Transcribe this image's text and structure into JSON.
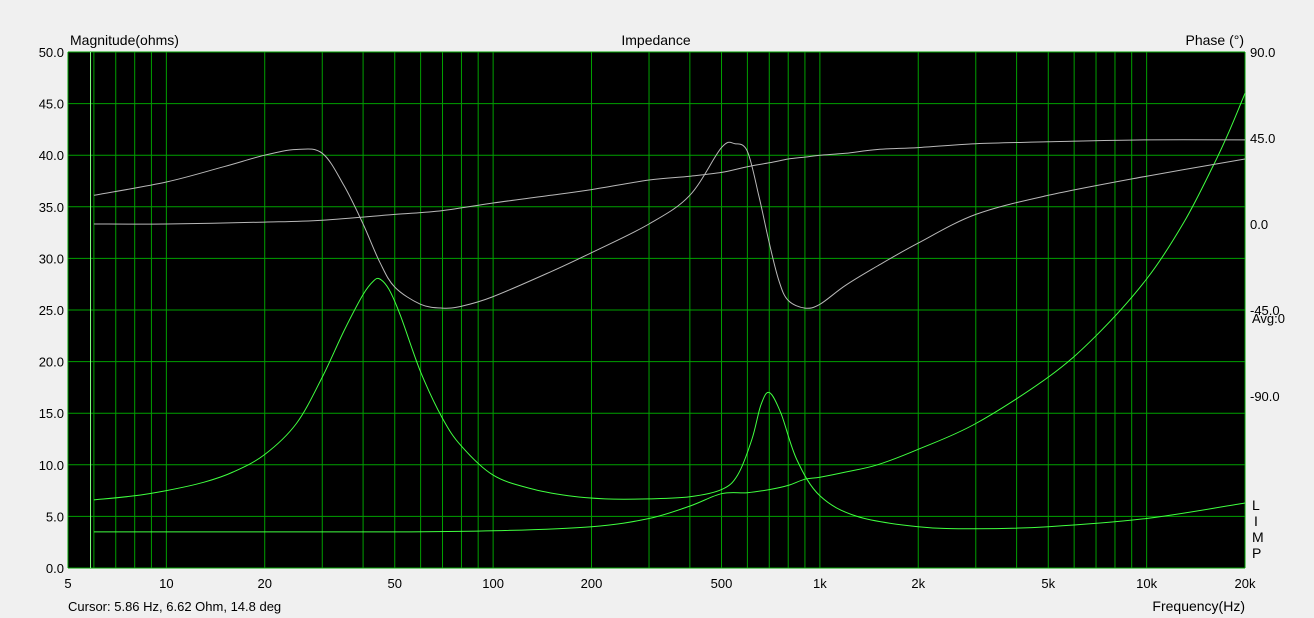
{
  "chart_data": {
    "type": "line",
    "title": "Impedance",
    "ylabel_left": "Magnitude(ohms)",
    "ylabel_right": "Phase (°)",
    "xlabel": "Frequency(Hz)",
    "x_scale": "log",
    "xlim": [
      5,
      20000
    ],
    "ylim_left": [
      0,
      50
    ],
    "ylim_right": [
      -180,
      90
    ],
    "x_ticks": [
      5,
      10,
      20,
      50,
      100,
      200,
      500,
      1000,
      2000,
      5000,
      10000,
      20000
    ],
    "x_tick_labels": [
      "5",
      "10",
      "20",
      "50",
      "100",
      "200",
      "500",
      "1k",
      "2k",
      "5k",
      "10k",
      "20k"
    ],
    "y_ticks_left": [
      0,
      5,
      10,
      15,
      20,
      25,
      30,
      35,
      40,
      45,
      50
    ],
    "y_tick_labels_left": [
      "0.0",
      "5.0",
      "10.0",
      "15.0",
      "20.0",
      "25.0",
      "30.0",
      "35.0",
      "40.0",
      "45.0",
      "50.0"
    ],
    "y_ticks_right": [
      90,
      45,
      0,
      -45,
      -90
    ],
    "y_tick_labels_right": [
      "90.0",
      "45.0",
      "0.0",
      "-45.0",
      "-90.0"
    ],
    "avg_label": "Avg:0",
    "grid": true,
    "legend_letters": [
      "L",
      "I",
      "M",
      "P"
    ],
    "cursor_readout": "Cursor: 5.86 Hz, 6.62 Ohm, 14.8 deg",
    "colors": {
      "plot_bg": "#000000",
      "grid": "#00a000",
      "magnitude": "#40ff40",
      "phase": "#b8b8b8"
    },
    "series": [
      {
        "axis": "left",
        "color": "#40ff40",
        "x": [
          6,
          8,
          10,
          13,
          16,
          20,
          25,
          30,
          35,
          40,
          43,
          45,
          48,
          52,
          60,
          70,
          80,
          100,
          130,
          170,
          220,
          300,
          400,
          500,
          560,
          620,
          660,
          700,
          760,
          850,
          1000,
          1300,
          2000,
          3000,
          5000,
          10000,
          20000
        ],
        "y": [
          6.6,
          7.0,
          7.5,
          8.3,
          9.3,
          11.0,
          14.0,
          18.5,
          23.0,
          26.5,
          27.8,
          28.0,
          27.0,
          24.5,
          19.0,
          14.5,
          11.8,
          9.0,
          7.7,
          7.0,
          6.7,
          6.7,
          6.9,
          7.6,
          9.0,
          12.5,
          15.8,
          17.0,
          15.0,
          10.5,
          7.0,
          5.0,
          4.0,
          3.8,
          4.0,
          4.8,
          6.3
        ]
      },
      {
        "axis": "left",
        "color": "#40ff40",
        "x": [
          6,
          20,
          50,
          100,
          200,
          300,
          400,
          500,
          600,
          700,
          800,
          900,
          1000,
          1200,
          1500,
          2000,
          3000,
          5000,
          7000,
          10000,
          13000,
          16000,
          18000,
          20000
        ],
        "y": [
          3.5,
          3.5,
          3.5,
          3.6,
          4.0,
          4.8,
          6.0,
          7.2,
          7.3,
          7.6,
          8.0,
          8.6,
          8.8,
          9.3,
          10.0,
          11.5,
          14.0,
          18.5,
          22.5,
          28.0,
          33.5,
          39.0,
          42.5,
          46.0
        ]
      },
      {
        "axis": "right",
        "color": "#b8b8b8",
        "x": [
          6,
          10,
          15,
          20,
          25,
          30,
          35,
          40,
          45,
          50,
          60,
          70,
          80,
          100,
          150,
          200,
          300,
          400,
          500,
          550,
          600,
          650,
          700,
          750,
          800,
          900,
          1000,
          1200,
          1500,
          2000,
          3000,
          5000,
          10000,
          20000
        ],
        "y": [
          15,
          22,
          30,
          36,
          39,
          37,
          20,
          0,
          -20,
          -33,
          -42,
          -44,
          -43,
          -38,
          -25,
          -15,
          0,
          15,
          40,
          42,
          38,
          15,
          -10,
          -30,
          -40,
          -44,
          -42,
          -32,
          -22,
          -10,
          5,
          15,
          25,
          34
        ]
      },
      {
        "axis": "right",
        "color": "#b8b8b8",
        "x": [
          6,
          10,
          20,
          30,
          50,
          70,
          100,
          150,
          200,
          300,
          400,
          500,
          600,
          700,
          800,
          900,
          1000,
          1200,
          1500,
          2000,
          3000,
          5000,
          10000,
          20000
        ],
        "y": [
          0,
          0,
          1,
          2,
          5,
          7,
          11,
          15,
          18,
          23,
          25,
          27,
          30,
          32,
          34,
          35,
          36,
          37,
          39,
          40,
          42,
          43,
          44,
          44
        ]
      }
    ]
  }
}
